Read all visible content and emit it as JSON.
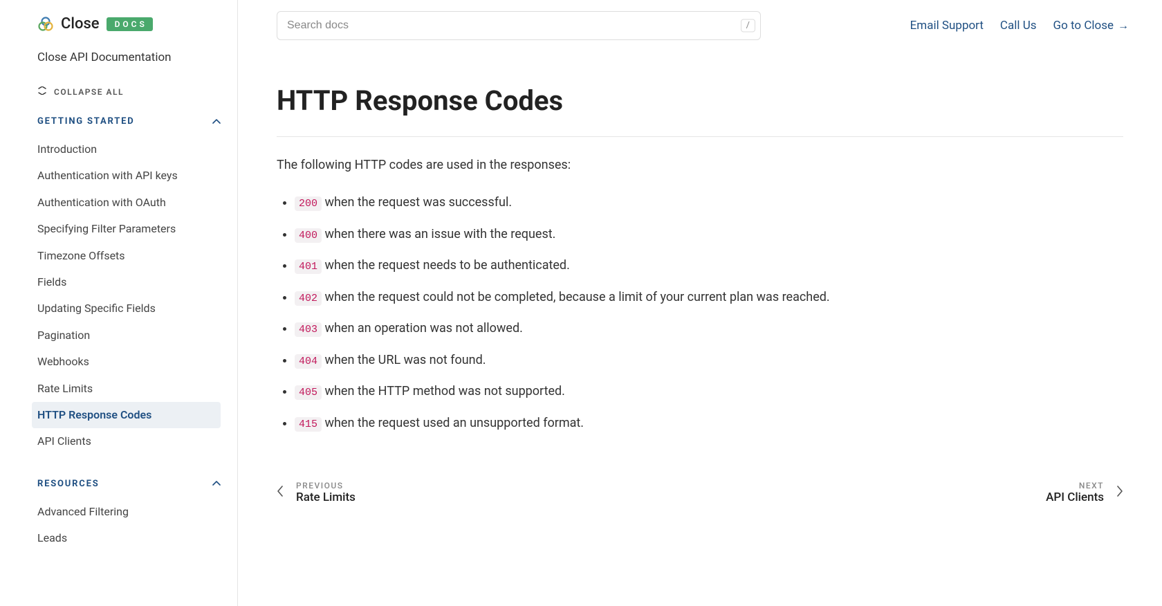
{
  "brand": {
    "name": "Close",
    "badge": "DOCS"
  },
  "site_title": "Close API Documentation",
  "collapse_all_label": "COLLAPSE ALL",
  "search": {
    "placeholder": "Search docs",
    "shortcut": "/"
  },
  "top_links": {
    "email": "Email Support",
    "call": "Call Us",
    "goto": "Go to Close"
  },
  "sidebar": {
    "sections": [
      {
        "label": "GETTING STARTED",
        "items": [
          "Introduction",
          "Authentication with API keys",
          "Authentication with OAuth",
          "Specifying Filter Parameters",
          "Timezone Offsets",
          "Fields",
          "Updating Specific Fields",
          "Pagination",
          "Webhooks",
          "Rate Limits",
          "HTTP Response Codes",
          "API Clients"
        ],
        "active_index": 10
      },
      {
        "label": "RESOURCES",
        "items": [
          "Advanced Filtering",
          "Leads"
        ],
        "active_index": -1
      }
    ]
  },
  "page": {
    "title": "HTTP Response Codes",
    "intro": "The following HTTP codes are used in the responses:",
    "codes": [
      {
        "code": "200",
        "desc": " when the request was successful."
      },
      {
        "code": "400",
        "desc": " when there was an issue with the request."
      },
      {
        "code": "401",
        "desc": " when the request needs to be authenticated."
      },
      {
        "code": "402",
        "desc": " when the request could not be completed, because a limit of your current plan was reached."
      },
      {
        "code": "403",
        "desc": " when an operation was not allowed."
      },
      {
        "code": "404",
        "desc": " when the URL was not found."
      },
      {
        "code": "405",
        "desc": " when the HTTP method was not supported."
      },
      {
        "code": "415",
        "desc": " when the request used an unsupported format."
      }
    ],
    "prev": {
      "kicker": "PREVIOUS",
      "title": "Rate Limits"
    },
    "next": {
      "kicker": "NEXT",
      "title": "API Clients"
    }
  }
}
